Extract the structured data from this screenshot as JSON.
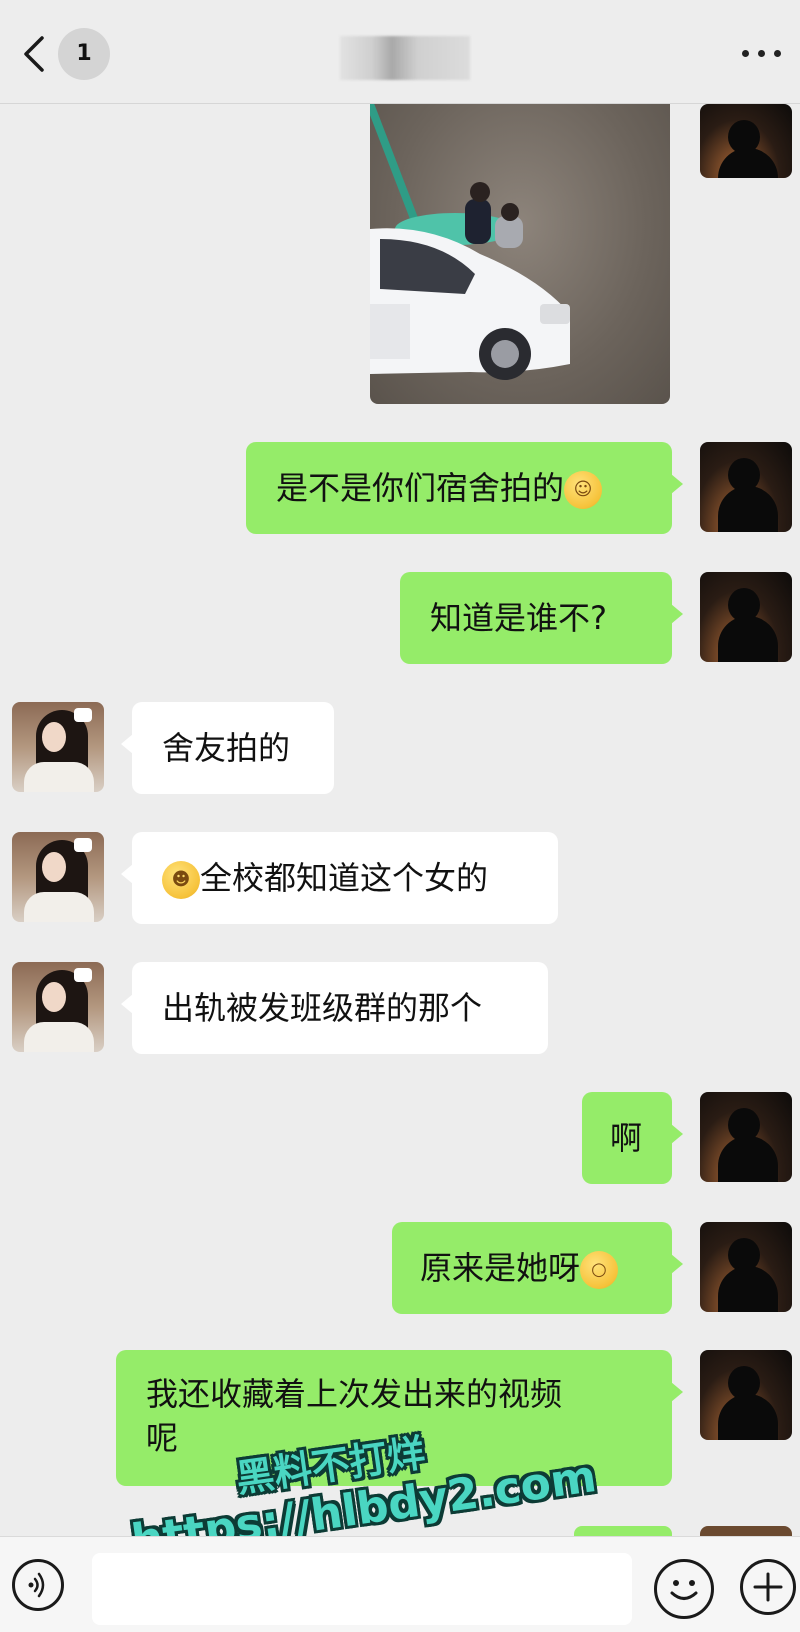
{
  "header": {
    "unread_count": "1",
    "contact_name_blurred": ""
  },
  "icons": {
    "back": "chevron-left-icon",
    "more": "more-horizontal-icon",
    "voice": "voice-icon",
    "emoji": "emoji-icon",
    "plus": "plus-icon"
  },
  "colors": {
    "sent_bubble": "#95ec69",
    "received_bubble": "#ffffff",
    "background": "#ededed",
    "watermark": "#4ad6c2"
  },
  "messages": [
    {
      "side": "right",
      "type": "image",
      "text": ""
    },
    {
      "side": "right",
      "type": "text",
      "text": "是不是你们宿舍拍的",
      "emoji": "thinking-emoji"
    },
    {
      "side": "right",
      "type": "text",
      "text": "知道是谁不?"
    },
    {
      "side": "left",
      "type": "text",
      "text": "舍友拍的"
    },
    {
      "side": "left",
      "type": "text",
      "text": "全校都知道这个女的",
      "emoji": "crying-laughing-emoji"
    },
    {
      "side": "left",
      "type": "text",
      "text": "出轨被发班级群的那个"
    },
    {
      "side": "right",
      "type": "text",
      "text": "啊"
    },
    {
      "side": "right",
      "type": "text",
      "text": "原来是她呀",
      "emoji": "shocked-emoji"
    },
    {
      "side": "right",
      "type": "text",
      "text": "我还收藏着上次发出来的视频",
      "text_line2": "呢"
    }
  ],
  "watermark": {
    "line1": "黑料不打烊",
    "line2": "https://hlbdy2.com"
  },
  "input": {
    "value": "",
    "placeholder": ""
  }
}
